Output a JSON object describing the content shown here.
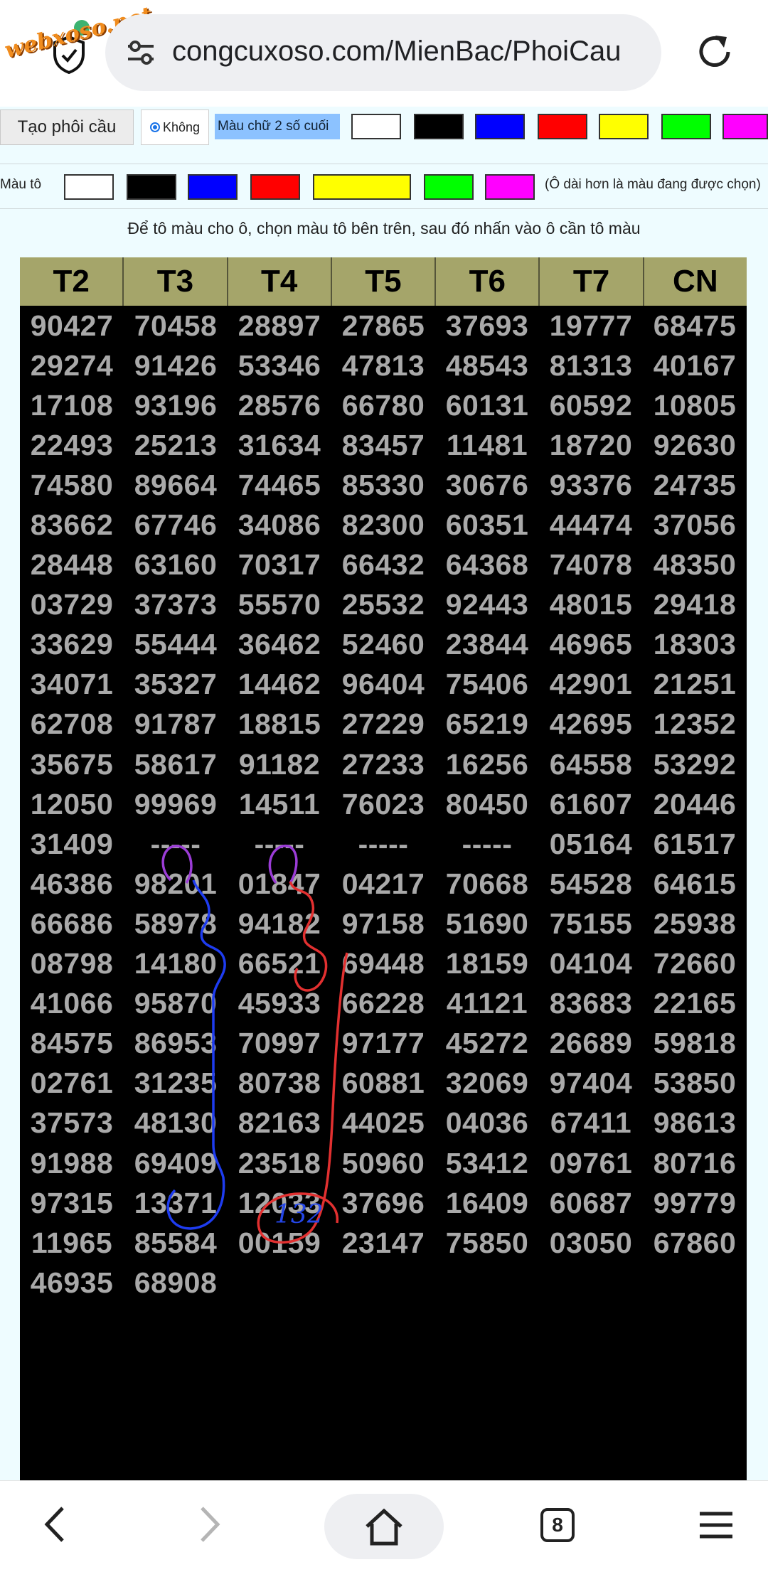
{
  "browser": {
    "url": "congcuxoso.com/MienBac/PhoiCau",
    "watermark": "webxoso.net",
    "tab_count": "8"
  },
  "toolbar": {
    "create_button": "Tạo phôi cầu",
    "radio_option": "Không",
    "text_color_label": "Màu chữ 2 số cuối",
    "fill_label": "Màu tô",
    "fill_hint": "(Ô dài hơn là màu đang được chọn)",
    "instruction": "Để tô màu cho ô, chọn màu tô bên trên, sau đó nhấn vào ô cần tô màu",
    "swatch_colors": [
      "#ffffff",
      "#000000",
      "#0000ff",
      "#ff0000",
      "#ffff00",
      "#00ff00",
      "#ff00ff"
    ],
    "selected_fill": "#ffff00"
  },
  "grid": {
    "headers": [
      "T2",
      "T3",
      "T4",
      "T5",
      "T6",
      "T7",
      "CN"
    ],
    "rows": [
      [
        "90427",
        "70458",
        "28897",
        "27865",
        "37693",
        "19777",
        "68475"
      ],
      [
        "29274",
        "91426",
        "53346",
        "47813",
        "48543",
        "81313",
        "40167"
      ],
      [
        "17108",
        "93196",
        "28576",
        "66780",
        "60131",
        "60592",
        "10805"
      ],
      [
        "22493",
        "25213",
        "31634",
        "83457",
        "11481",
        "18720",
        "92630"
      ],
      [
        "74580",
        "89664",
        "74465",
        "85330",
        "30676",
        "93376",
        "24735"
      ],
      [
        "83662",
        "67746",
        "34086",
        "82300",
        "60351",
        "44474",
        "37056"
      ],
      [
        "28448",
        "63160",
        "70317",
        "66432",
        "64368",
        "74078",
        "48350"
      ],
      [
        "03729",
        "37373",
        "55570",
        "25532",
        "92443",
        "48015",
        "29418"
      ],
      [
        "33629",
        "55444",
        "36462",
        "52460",
        "23844",
        "46965",
        "18303"
      ],
      [
        "34071",
        "35327",
        "14462",
        "96404",
        "75406",
        "42901",
        "21251"
      ],
      [
        "62708",
        "91787",
        "18815",
        "27229",
        "65219",
        "42695",
        "12352"
      ],
      [
        "35675",
        "58617",
        "91182",
        "27233",
        "16256",
        "64558",
        "53292"
      ],
      [
        "12050",
        "99969",
        "14511",
        "76023",
        "80450",
        "61607",
        "20446"
      ],
      [
        "31409",
        "-----",
        "-----",
        "-----",
        "-----",
        "05164",
        "61517"
      ],
      [
        "46386",
        "98201",
        "01847",
        "04217",
        "70668",
        "54528",
        "64615"
      ],
      [
        "66686",
        "58978",
        "94182",
        "97158",
        "51690",
        "75155",
        "25938"
      ],
      [
        "08798",
        "14180",
        "66521",
        "69448",
        "18159",
        "04104",
        "72660"
      ],
      [
        "41066",
        "95870",
        "45933",
        "66228",
        "41121",
        "83683",
        "22165"
      ],
      [
        "84575",
        "86953",
        "70997",
        "97177",
        "45272",
        "26689",
        "59818"
      ],
      [
        "02761",
        "31235",
        "80738",
        "60881",
        "32069",
        "97404",
        "53850"
      ],
      [
        "37573",
        "48130",
        "82163",
        "44025",
        "04036",
        "67411",
        "98613"
      ],
      [
        "91988",
        "69409",
        "23518",
        "50960",
        "53412",
        "09761",
        "80716"
      ],
      [
        "97315",
        "13371",
        "12033",
        "37696",
        "16409",
        "60687",
        "99779"
      ],
      [
        "11965",
        "85584",
        "00159",
        "23147",
        "75850",
        "03050",
        "67860"
      ],
      [
        "46935",
        "68908",
        "",
        "",
        "",
        "",
        ""
      ]
    ],
    "annotation_text": "132"
  }
}
